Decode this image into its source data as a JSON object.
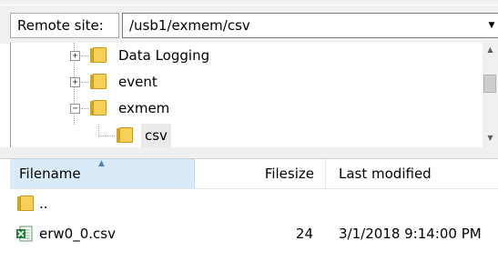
{
  "remote_site": {
    "label": "Remote site:",
    "path": "/usb1/exmem/csv"
  },
  "tree": {
    "items": [
      {
        "label": "Data Logging",
        "expander": "+"
      },
      {
        "label": "event",
        "expander": "+"
      },
      {
        "label": "exmem",
        "expander": "−"
      },
      {
        "label": "csv"
      }
    ]
  },
  "file_list": {
    "columns": {
      "filename": "Filename",
      "filesize": "Filesize",
      "last_modified": "Last modified"
    },
    "rows": [
      {
        "name": "..",
        "size": "",
        "modified": "",
        "icon": "folder-icon"
      },
      {
        "name": "erw0_0.csv",
        "size": "24",
        "modified": "3/1/2018 9:14:00 PM",
        "icon": "excel-csv-icon"
      }
    ]
  },
  "colors": {
    "folder": "#f5d158",
    "header_selected": "#d9ebf9",
    "excel_green": "#1f7a3a"
  }
}
